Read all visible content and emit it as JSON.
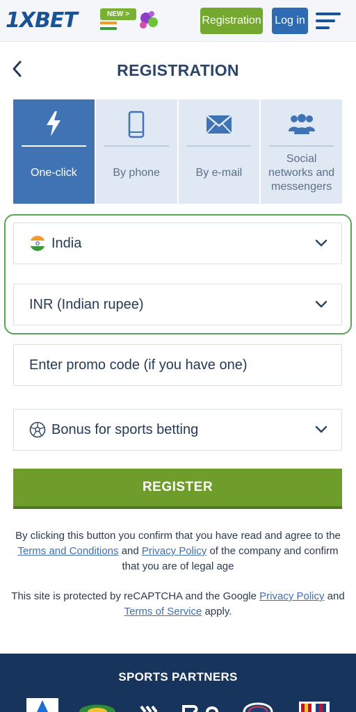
{
  "header": {
    "logo": "1XBET",
    "new_badge": "NEW >",
    "registration_label": "Registration",
    "login_label": "Log in"
  },
  "page": {
    "title": "REGISTRATION"
  },
  "tabs": [
    {
      "label": "One-click",
      "icon": "lightning-icon",
      "active": true
    },
    {
      "label": "By phone",
      "icon": "phone-icon",
      "active": false
    },
    {
      "label": "By e-mail",
      "icon": "envelope-icon",
      "active": false
    },
    {
      "label": "Social networks and messengers",
      "icon": "people-icon",
      "active": false
    }
  ],
  "form": {
    "country": "India",
    "currency": "INR (Indian rupee)",
    "promo_placeholder": "Enter promo code (if you have one)",
    "bonus": "Bonus for sports betting",
    "register_label": "REGISTER"
  },
  "legal": {
    "p1_start": "By clicking this button you confirm that you have read and agree to the",
    "terms_link": "Terms and Conditions",
    "and": "and",
    "privacy_link": "Privacy Policy",
    "p1_end": "of the company and confirm that you are of legal age",
    "p2_start": "This site is protected by reCAPTCHA and the Google",
    "privacy_link_2": "Privacy Policy",
    "and_2": "and",
    "tos_link": "Terms of Service",
    "p2_end": "apply."
  },
  "footer": {
    "title": "SPORTS PARTNERS"
  },
  "colors": {
    "brand_blue": "#1a5296",
    "green": "#74a82e",
    "tab_active": "#3f73b3",
    "footer_bg": "#17345d"
  }
}
